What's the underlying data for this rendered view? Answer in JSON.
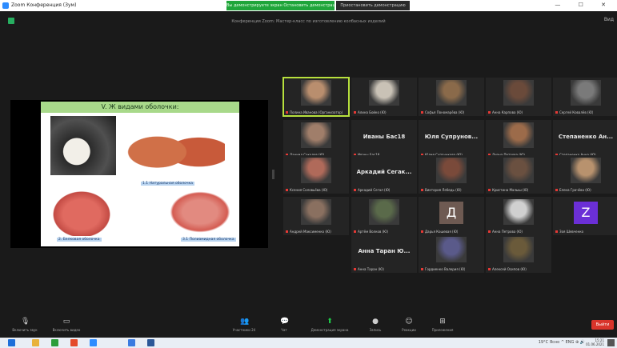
{
  "window": {
    "title": "Zoom Конференция (Зум)",
    "banner_green": "Вы демонстрируете экран  Остановить демонстрацию",
    "banner_dark": "Приостановить демонстрацию",
    "controls": "—  ☐  ✕"
  },
  "meeting": {
    "title": "Конференция Zoom: Мастер-класс по изготовлению колбасных изделий",
    "view_label": "Вид"
  },
  "slide": {
    "header": "V. Ж видами оболочки:",
    "caption_1": "1.1 Натуральная оболочка",
    "caption_2": "2. Белковая оболочка",
    "caption_3": "3.1 Полиамидная оболочка"
  },
  "gallery": [
    {
      "name": "Полина Иванова (Организатор)",
      "type": "video",
      "color": "#b98e6e",
      "active": true
    },
    {
      "name": "Алина Бойко (Ю)",
      "type": "video",
      "color": "#c9c2b6"
    },
    {
      "name": "Софья Пономарёва (Ю)",
      "type": "video",
      "color": "#8a6a4a"
    },
    {
      "name": "Анна Карпова (Ю)",
      "type": "video",
      "color": "#6a4a3a"
    },
    {
      "name": "Сергей Ковалёв (Ю)",
      "type": "video",
      "color": "#7a7a7a"
    },
    {
      "name": "Даниил Соколов (Ю)",
      "type": "video",
      "color": "#a07e6a"
    },
    {
      "name": "Иваны Бас18",
      "type": "name",
      "bigname": "Иваны Бас18"
    },
    {
      "name": "Юлия Супрункова (Ю)",
      "type": "name",
      "bigname": "Юля Супрунов..."
    },
    {
      "name": "Диана Петрова (Ю)",
      "type": "video",
      "color": "#9c6b4a"
    },
    {
      "name": "Степаненко Анна (Ю)",
      "type": "name",
      "bigname": "Степаненко Ан..."
    },
    {
      "name": "Ксения Соловьёва (Ю)",
      "type": "video",
      "color": "#b06a5a"
    },
    {
      "name": "Аркадий Сегал (Ю)",
      "type": "name",
      "bigname": "Аркадий Сегак..."
    },
    {
      "name": "Виктория Лебедь (Ю)",
      "type": "video",
      "color": "#7a4a3a"
    },
    {
      "name": "Кристина Малыш (Ю)",
      "type": "video",
      "color": "#6a5040"
    },
    {
      "name": "Елена Грачёва (Ю)",
      "type": "video",
      "color": "#b8926e"
    },
    {
      "name": "Андрей Максименко (Ю)",
      "type": "video",
      "color": "#8a7060"
    },
    {
      "name": "Артём Волков (Ю)",
      "type": "video",
      "color": "#5a6a4a"
    },
    {
      "name": "Дарья Кошевая (Ю)",
      "type": "letter",
      "letter": "Д",
      "color": "#6e5a52"
    },
    {
      "name": "Анна Петрова (Ю)",
      "type": "video",
      "color": "#d0d0d0"
    },
    {
      "name": "Зоя Шевченко",
      "type": "letter",
      "letter": "Z",
      "color": "#6b2fd6"
    },
    {
      "name": "Анна Таран (Ю)",
      "type": "name",
      "bigname": "Анна Таран Ю..."
    },
    {
      "name": "Гордиенко Валерия (Ю)",
      "type": "video",
      "color": "#5a5a8a"
    },
    {
      "name": "Алексей Осипов (Ю)",
      "type": "video",
      "color": "#6a5a3a"
    }
  ],
  "toolbar": {
    "mute_label": "Включить звук",
    "video_label": "Включить видео",
    "participants_label": "Участники",
    "participants_count": "24",
    "chat_label": "Чат",
    "share_label": "Демонстрация экрана",
    "record_label": "Запись",
    "reactions_label": "Реакции",
    "apps_label": "Приложения",
    "end_label": "Выйти"
  },
  "taskbar": {
    "weather": "19°C Ясно",
    "system_tray": "^  ENG  ⊕  🔊",
    "time": "15:21",
    "date": "01.06.2021"
  },
  "colors": {
    "background": "#1a1a1a",
    "active_speaker": "#b7e03d",
    "share_green": "#1fa53a",
    "end_red": "#d9342b"
  }
}
